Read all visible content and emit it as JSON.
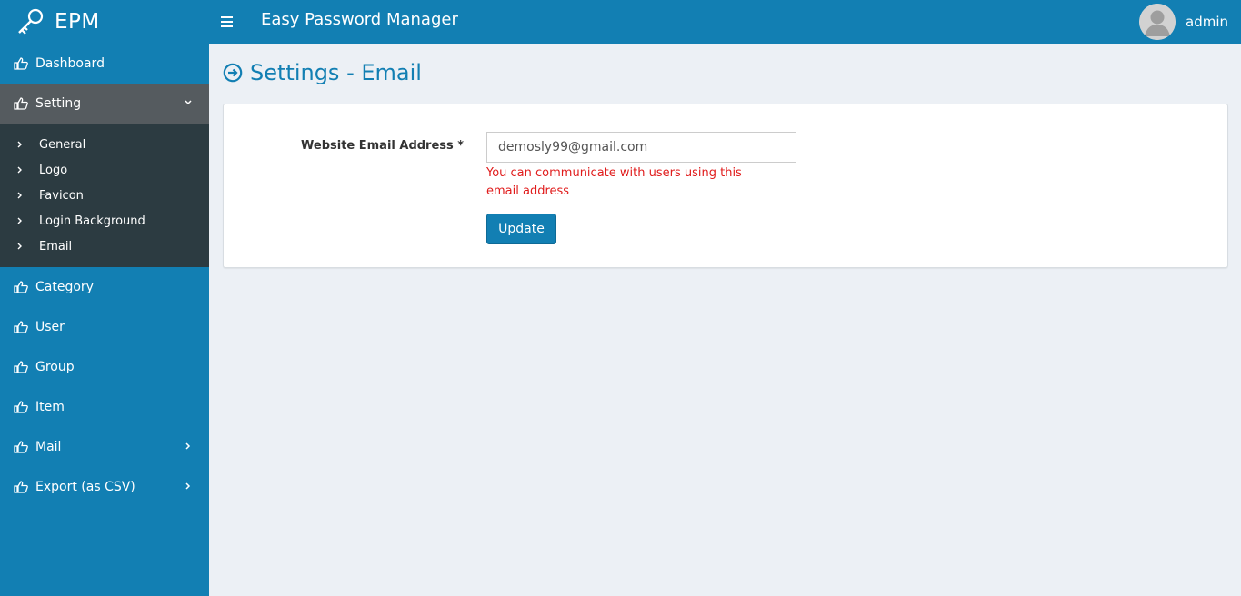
{
  "header": {
    "logo_text": "EPM",
    "app_title": "Easy Password Manager",
    "user_name": "admin"
  },
  "sidebar": {
    "items": [
      {
        "label": "Dashboard"
      },
      {
        "label": "Setting"
      },
      {
        "label": "Category"
      },
      {
        "label": "User"
      },
      {
        "label": "Group"
      },
      {
        "label": "Item"
      },
      {
        "label": "Mail"
      },
      {
        "label": "Export (as CSV)"
      }
    ],
    "setting_submenu": [
      {
        "label": "General"
      },
      {
        "label": "Logo"
      },
      {
        "label": "Favicon"
      },
      {
        "label": "Login Background"
      },
      {
        "label": "Email"
      }
    ]
  },
  "main": {
    "page_title": "Settings - Email",
    "form": {
      "email_label": "Website Email Address *",
      "email_value": "demosly99@gmail.com",
      "help_text": "You can communicate with users using this email address",
      "update_label": "Update"
    }
  },
  "colors": {
    "primary": "#127fb3",
    "active_item": "#555b5f",
    "submenu_bg": "#2c3b41",
    "content_bg": "#ecf0f5",
    "help_text": "#e01b1b"
  },
  "icons": {
    "logo": "key-icon",
    "menu": "hamburger-icon",
    "nav": "hand-pointing-icon",
    "submenu": "chevron-right-icon",
    "title": "circle-arrow-right-icon"
  }
}
